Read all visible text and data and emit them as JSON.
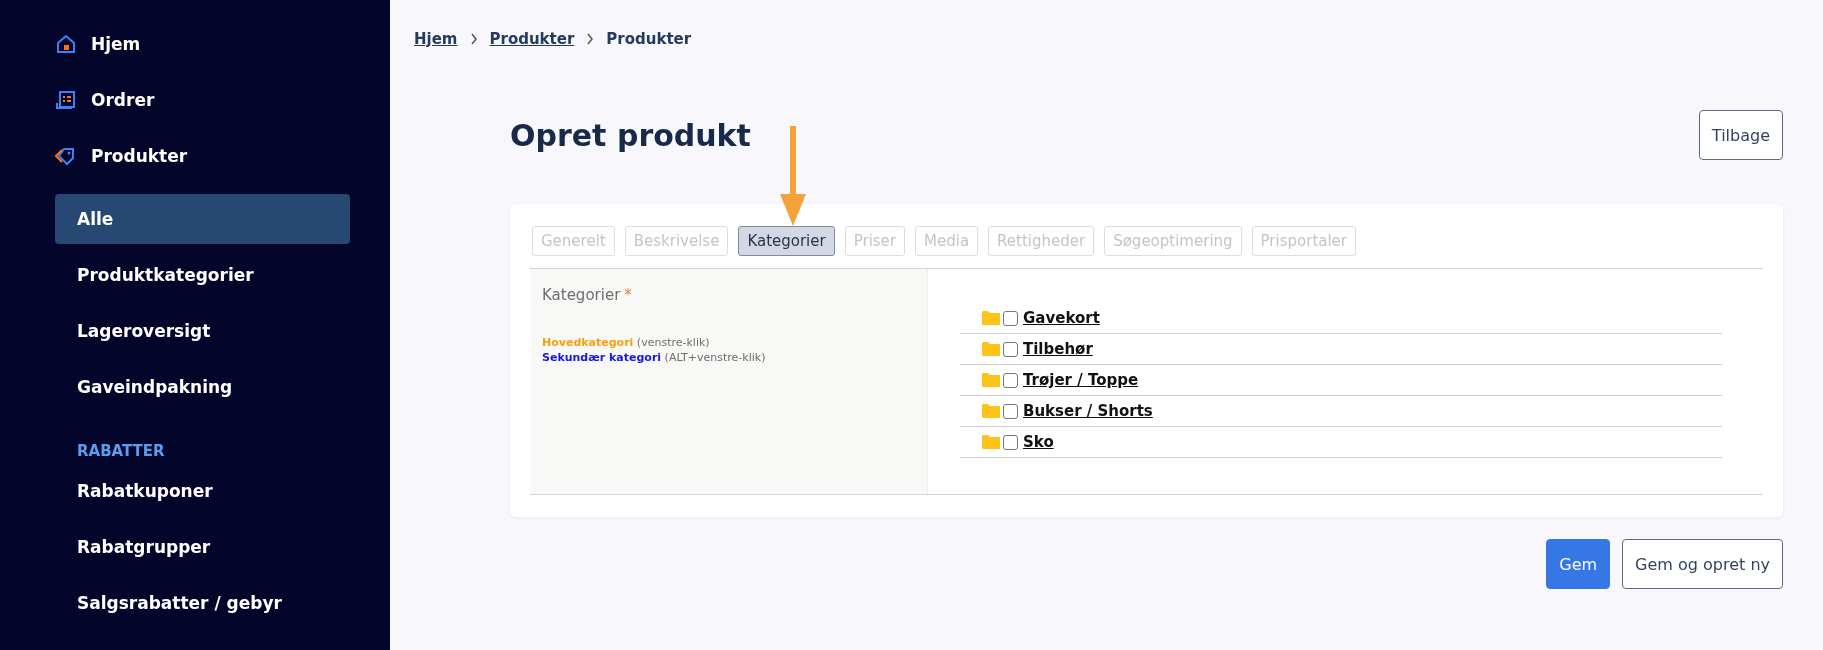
{
  "sidebar": {
    "items": [
      {
        "kind": "main",
        "label": "Hjem"
      },
      {
        "kind": "main",
        "label": "Ordrer"
      },
      {
        "kind": "main",
        "label": "Produkter"
      },
      {
        "kind": "sub",
        "label": "Alle",
        "selected": true
      },
      {
        "kind": "sub",
        "label": "Produktkategorier",
        "selected": false
      },
      {
        "kind": "sub",
        "label": "Lageroversigt",
        "selected": false
      },
      {
        "kind": "sub",
        "label": "Gaveindpakning",
        "selected": false
      },
      {
        "kind": "section",
        "label": "RABATTER"
      },
      {
        "kind": "sub",
        "label": "Rabatkuponer",
        "selected": false
      },
      {
        "kind": "sub",
        "label": "Rabatgrupper",
        "selected": false
      },
      {
        "kind": "sub",
        "label": "Salgsrabatter / gebyr",
        "selected": false
      }
    ]
  },
  "breadcrumb": [
    {
      "label": "Hjem",
      "link": true
    },
    {
      "label": "Produkter",
      "link": true
    },
    {
      "label": "Produkter",
      "link": false
    }
  ],
  "page": {
    "title": "Opret produkt",
    "back_button": "Tilbage"
  },
  "tabs": [
    {
      "label": "Generelt",
      "selected": false
    },
    {
      "label": "Beskrivelse",
      "selected": false
    },
    {
      "label": "Kategorier",
      "selected": true
    },
    {
      "label": "Priser",
      "selected": false
    },
    {
      "label": "Media",
      "selected": false
    },
    {
      "label": "Rettigheder",
      "selected": false
    },
    {
      "label": "Søgeoptimering",
      "selected": false
    },
    {
      "label": "Prisportaler",
      "selected": false
    }
  ],
  "categories_panel": {
    "label": "Kategorier",
    "required_mark": "*",
    "legend": [
      {
        "term": "Hovedkategori",
        "hint": "(venstre-klik)",
        "color": "#f5a00f"
      },
      {
        "term": "Sekundær kategori",
        "hint": "(ALT+venstre-klik)",
        "color": "#1a14e6"
      }
    ],
    "tree": [
      {
        "label": "Gavekort",
        "checked": false
      },
      {
        "label": "Tilbehør",
        "checked": false
      },
      {
        "label": "Trøjer / Toppe",
        "checked": false
      },
      {
        "label": "Bukser / Shorts",
        "checked": false
      },
      {
        "label": "Sko",
        "checked": false
      }
    ]
  },
  "actions": [
    {
      "label": "Gem",
      "kind": "primary"
    },
    {
      "label": "Gem og opret ny",
      "kind": "secondary"
    }
  ]
}
